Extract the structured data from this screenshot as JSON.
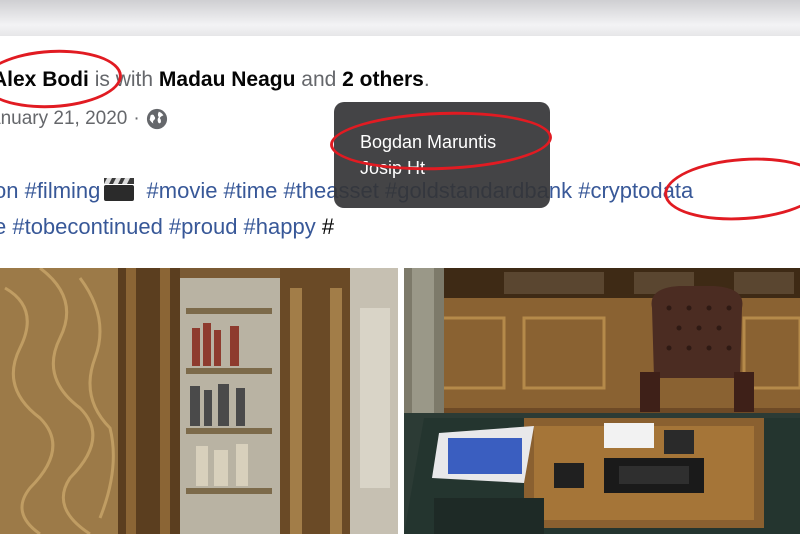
{
  "post": {
    "author": "Alex Bodi",
    "with_text": "is with",
    "tagged_person": "Madau Neagu",
    "and_text": "and",
    "others": "2 others",
    "period": ".",
    "date": "anuary 21, 2020",
    "date_sep": "·",
    "privacy_icon": "globe-icon",
    "hashtags_line1": [
      "on #filming",
      "#movie #time #theasset #goldstandardbank #cryptodata"
    ],
    "hashtags_line2": "e #tobecontinued #proud #happy",
    "hashtags_line2_tail": "#"
  },
  "tooltip": {
    "names": [
      "Bogdan Maruntis",
      "Josip Ht"
    ]
  },
  "colors": {
    "link": "#385898",
    "annotation_red": "#e11b22",
    "tooltip_bg": "#343436"
  }
}
